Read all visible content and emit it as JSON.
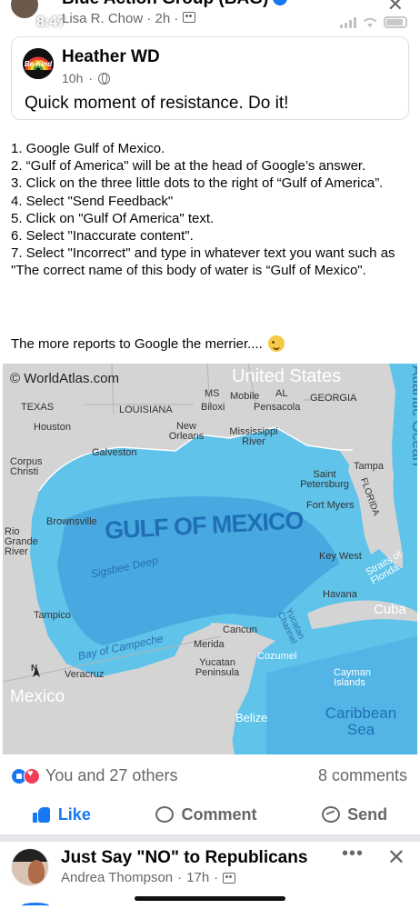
{
  "status_bar": {
    "time": "8:47"
  },
  "group_header": {
    "group_name": "Blue Action Group (BAG)",
    "author": "Lisa R. Chow",
    "time": "2h"
  },
  "shared_post": {
    "author": "Heather WD",
    "avatar_text": "Be Kind",
    "time": "10h",
    "text": "Quick moment of resistance. Do it!"
  },
  "post_body": {
    "lines": [
      "1. Google Gulf of Mexico.",
      "2. “Gulf of America\" will be at the head of Google’s answer.",
      "3. Click on the three little dots to the right of “Gulf of America”.",
      "4. Select \"Send Feedback\"",
      "5. Click on \"Gulf Of America\" text.",
      "6. Select \"Inaccurate content\".",
      "7. Select \"Incorrect\" and type in whatever text you want such as \"The correct name of this body of water is “Gulf of Mexico\"."
    ],
    "closing": "The more reports to Google the merrier...."
  },
  "map": {
    "credit": "© WorldAtlas.com",
    "labels": {
      "united_states": "United States",
      "atlantic": "Atlantic Ocean",
      "texas": "TEXAS",
      "louisiana": "LOUISIANA",
      "ms": "MS",
      "al": "AL",
      "georgia": "GEORGIA",
      "florida": "FLORIDA",
      "houston": "Houston",
      "galveston": "Galveston",
      "corpus": "Corpus Christi",
      "new_orleans": "New Orleans",
      "biloxi": "Biloxi",
      "mobile": "Mobile",
      "pensacola": "Pensacola",
      "mississippi": "Mississippi River",
      "tampa": "Tampa",
      "st_pete": "Saint Petersburg",
      "fort_myers": "Fort Myers",
      "key_west": "Key West",
      "straits": "Straits of Florida",
      "havana": "Havana",
      "cuba": "Cuba",
      "brownsville": "Brownsville",
      "rio_grande": "Rio Grande River",
      "gulf": "GULF OF MEXICO",
      "sigsbee": "Sigsbee Deep",
      "tampico": "Tampico",
      "campeche": "Bay of Campeche",
      "veracruz": "Veracruz",
      "mexico": "Mexico",
      "north": "N",
      "cancun": "Cancun",
      "merida": "Merida",
      "yucatan_pen": "Yucatan Peninsula",
      "yucatan_channel": "Yucatan Channel",
      "cozumel": "Cozumel",
      "cayman": "Cayman Islands",
      "belize": "Belize",
      "caribbean": "Caribbean Sea"
    }
  },
  "reactions": {
    "summary": "You and 27 others",
    "comments": "8 comments"
  },
  "actions": {
    "like": "Like",
    "comment": "Comment",
    "send": "Send"
  },
  "next_post": {
    "group": "Just Say \"NO\" to Republicans",
    "author": "Andrea Thompson",
    "time": "17h",
    "more": "•••",
    "close": "✕"
  },
  "colors": {
    "facebook_blue": "#1877f2",
    "secondary_text": "#65676b",
    "gulf_water": "#5fc3ea",
    "deep_water": "#47a9e0",
    "land": "#d4d4d4"
  }
}
